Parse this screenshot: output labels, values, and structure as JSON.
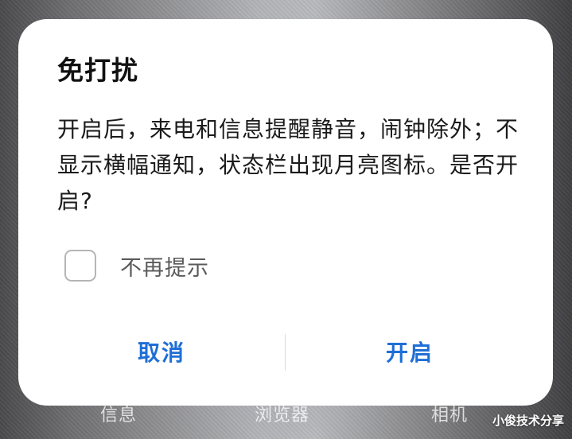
{
  "background": {
    "dock_labels": [
      "信息",
      "浏览器",
      "相机"
    ],
    "watermark": "小俊技术分享"
  },
  "dialog": {
    "title": "免打扰",
    "message": "开启后，来电和信息提醒静音，闹钟除外；不显示横幅通知，状态栏出现月亮图标。是否开启?",
    "checkbox": {
      "label": "不再提示",
      "checked": false
    },
    "buttons": {
      "cancel_label": "取消",
      "confirm_label": "开启"
    },
    "accent_color": "#1f6fd6"
  }
}
